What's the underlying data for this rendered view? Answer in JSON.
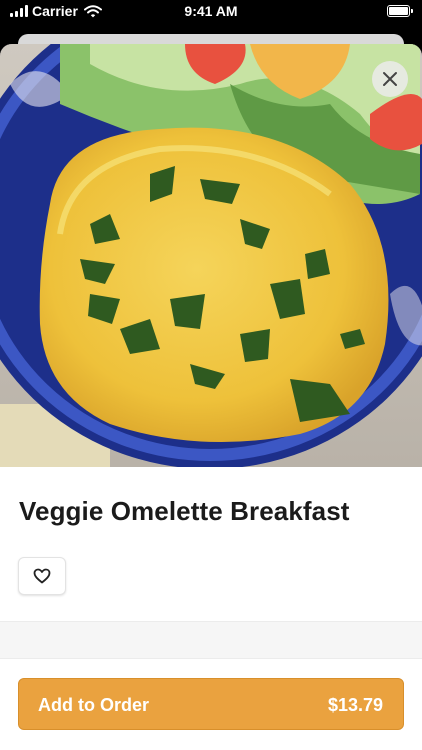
{
  "status_bar": {
    "carrier": "Carrier",
    "time": "9:41 AM"
  },
  "item": {
    "title": "Veggie Omelette Breakfast",
    "image_alt": "Veggie omelette on a blue plate with a side salad"
  },
  "actions": {
    "add_label": "Add to Order",
    "price": "$13.79"
  },
  "icons": {
    "close": "close-icon",
    "favorite": "heart-icon",
    "wifi": "wifi-icon",
    "battery": "battery-icon"
  },
  "colors": {
    "accent": "#eaa23f",
    "accent_border": "#d88f2b",
    "title": "#1b1b1b"
  }
}
